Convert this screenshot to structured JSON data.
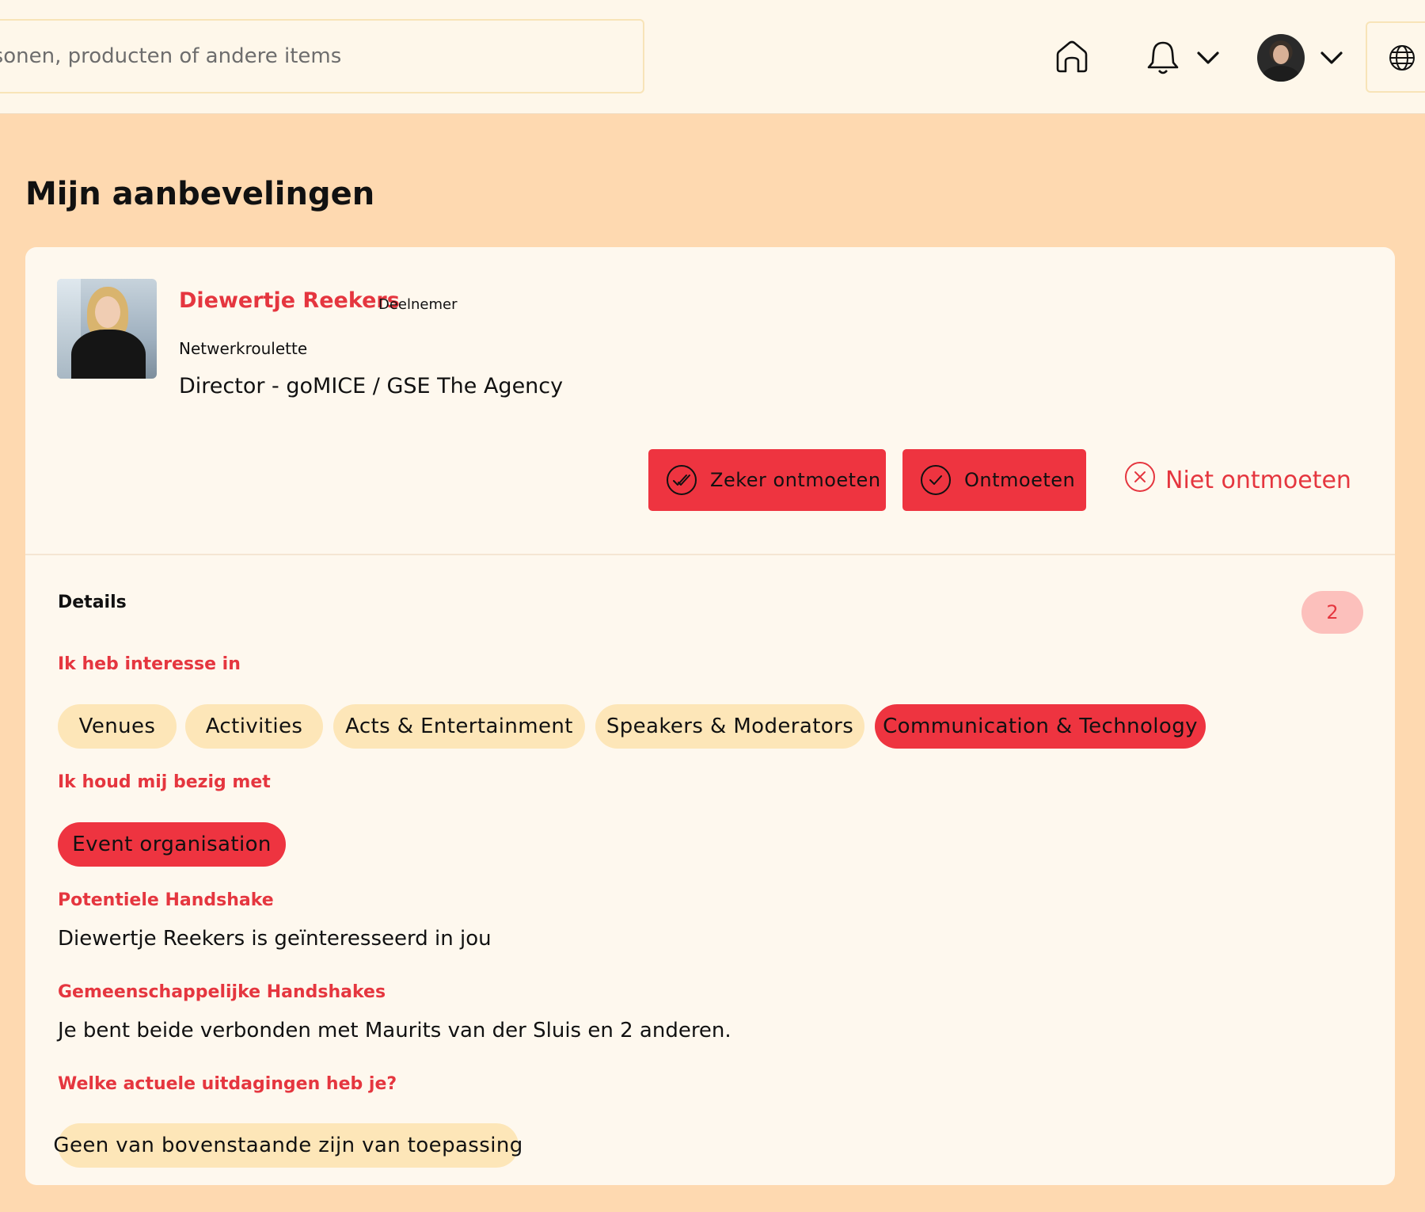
{
  "header": {
    "search_placeholder": "ersonen, producten of andere items",
    "icons": [
      "home-icon",
      "bell-icon",
      "chevron-down-icon",
      "avatar",
      "chevron-down-icon",
      "globe-icon"
    ]
  },
  "page": {
    "title": "Mijn aanbevelingen"
  },
  "recommendation": {
    "name": "Diewertje Reekers",
    "role": "Deelnemer",
    "source": "Netwerkroulette",
    "job_title": "Director - goMICE / GSE The Agency",
    "actions": {
      "sure_meet": "Zeker ontmoeten",
      "meet": "Ontmoeten",
      "no_meet": "Niet ontmoeten"
    },
    "details_label": "Details",
    "count": "2",
    "interest_label": "Ik heb interesse in",
    "interests": [
      {
        "label": "Venues",
        "active": false
      },
      {
        "label": "Activities",
        "active": false
      },
      {
        "label": "Acts & Entertainment",
        "active": false
      },
      {
        "label": "Speakers & Moderators",
        "active": false
      },
      {
        "label": "Communication & Technology",
        "active": true
      }
    ],
    "busy_label": "Ik houd mij bezig met",
    "busy_items": [
      {
        "label": "Event organisation",
        "active": true
      }
    ],
    "handshake_label": "Potentiele Handshake",
    "handshake_text": "Diewertje Reekers is geïnteresseerd in jou",
    "common_label": "Gemeenschappelijke Handshakes",
    "common_text": "Je bent beide verbonden met Maurits van der Sluis en 2 anderen.",
    "challenges_label": "Welke actuele uitdagingen heb je?",
    "challenges": [
      {
        "label": "Geen van bovenstaande zijn van toepassing",
        "active": false
      }
    ]
  },
  "colors": {
    "page_bg": "#fed9b0",
    "topbar_bg": "#fef7ea",
    "card_bg": "#fef8ee",
    "accent": "#ee3440",
    "accent_text": "#e5363f",
    "chip_bg": "#fde6b8",
    "badge_bg": "#fcc0bc"
  }
}
